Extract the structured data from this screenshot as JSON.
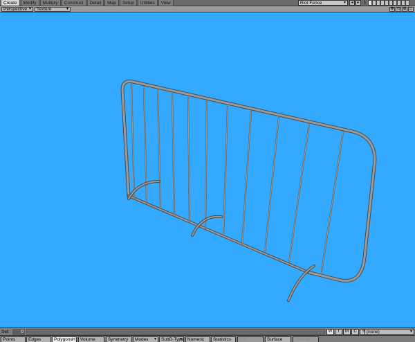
{
  "tabs": [
    {
      "label": "Create",
      "active": true
    },
    {
      "label": "Modify",
      "active": false
    },
    {
      "label": "Multiply",
      "active": false
    },
    {
      "label": "Construct",
      "active": false
    },
    {
      "label": "Detail",
      "active": false
    },
    {
      "label": "Map",
      "active": false
    },
    {
      "label": "Setup",
      "active": false
    },
    {
      "label": "Utilities",
      "active": false
    },
    {
      "label": "View",
      "active": false
    }
  ],
  "object_selector": {
    "value": "Riot Fence"
  },
  "nav_buttons": [
    "◂",
    "▸",
    "⚙"
  ],
  "layers": {
    "label": "1",
    "count": 10
  },
  "viewport": {
    "view_mode": "Perspective",
    "render_mode": "Texture",
    "background_color": "#33aaff",
    "model_color": "#8a8a8a",
    "icons": [
      "move-view-icon",
      "rotate-view-icon",
      "zoom-view-icon",
      "maximize-view-icon"
    ]
  },
  "status_row": {
    "sel_label": "Sel:",
    "sel_count": "0",
    "tmcs": [
      {
        "label": "W",
        "active": true
      },
      {
        "label": "T",
        "active": false
      },
      {
        "label": "M",
        "active": false
      },
      {
        "label": "C",
        "active": false
      },
      {
        "label": "S",
        "active": false
      }
    ],
    "surface": "(none)"
  },
  "bottom_bar": {
    "points": "Points",
    "edges": "Edges",
    "polygons": "Polygons",
    "polygons_hint": "H",
    "volume": "Volume",
    "symmetry": "Symmetry",
    "modes": "Modes",
    "subd_type": "SubD-Type",
    "numeric": "Numeric",
    "statistics": "Statistics",
    "info": "Info",
    "surface": "Surface",
    "unwrap": "Unwrap"
  }
}
